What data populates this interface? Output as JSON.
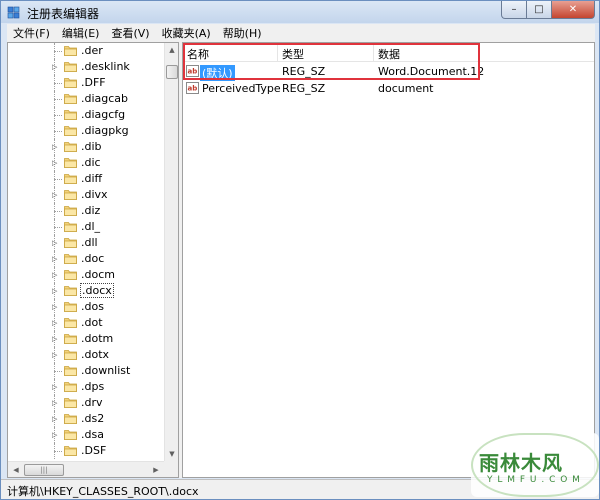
{
  "window": {
    "title": "注册表编辑器",
    "minimize_glyph": "–",
    "maximize_glyph": "□",
    "close_glyph": "✕"
  },
  "menu": [
    {
      "label": "文件(F)"
    },
    {
      "label": "编辑(E)"
    },
    {
      "label": "查看(V)"
    },
    {
      "label": "收藏夹(A)"
    },
    {
      "label": "帮助(H)"
    }
  ],
  "tree": {
    "items": [
      {
        "label": ".der",
        "expandable": false
      },
      {
        "label": ".desklink",
        "expandable": true
      },
      {
        "label": ".DFF",
        "expandable": false
      },
      {
        "label": ".diagcab",
        "expandable": false
      },
      {
        "label": ".diagcfg",
        "expandable": false
      },
      {
        "label": ".diagpkg",
        "expandable": false
      },
      {
        "label": ".dib",
        "expandable": true
      },
      {
        "label": ".dic",
        "expandable": true
      },
      {
        "label": ".diff",
        "expandable": false
      },
      {
        "label": ".divx",
        "expandable": true
      },
      {
        "label": ".diz",
        "expandable": false
      },
      {
        "label": ".dl_",
        "expandable": false
      },
      {
        "label": ".dll",
        "expandable": true
      },
      {
        "label": ".doc",
        "expandable": true
      },
      {
        "label": ".docm",
        "expandable": true
      },
      {
        "label": ".docx",
        "expandable": true,
        "selected": true
      },
      {
        "label": ".dos",
        "expandable": true
      },
      {
        "label": ".dot",
        "expandable": true
      },
      {
        "label": ".dotm",
        "expandable": true
      },
      {
        "label": ".dotx",
        "expandable": true
      },
      {
        "label": ".downlist",
        "expandable": false
      },
      {
        "label": ".dps",
        "expandable": true
      },
      {
        "label": ".drv",
        "expandable": true
      },
      {
        "label": ".ds2",
        "expandable": true
      },
      {
        "label": ".dsa",
        "expandable": true
      },
      {
        "label": ".DSF",
        "expandable": false
      }
    ]
  },
  "list": {
    "columns": [
      "名称",
      "类型",
      "数据"
    ],
    "rows": [
      {
        "name": "(默认)",
        "type": "REG_SZ",
        "data": "Word.Document.12",
        "selected": true
      },
      {
        "name": "PerceivedType",
        "type": "REG_SZ",
        "data": "document",
        "selected": false
      }
    ],
    "highlight_color": "#e0333c"
  },
  "status": {
    "path": "计算机\\HKEY_CLASSES_ROOT\\.docx"
  },
  "watermark": {
    "title": "雨林木风",
    "sub": "Y L M F U . C O M"
  },
  "icons": {
    "app": "registry-editor-icon",
    "folder": "folder-icon",
    "string_value": "string-value-icon"
  }
}
